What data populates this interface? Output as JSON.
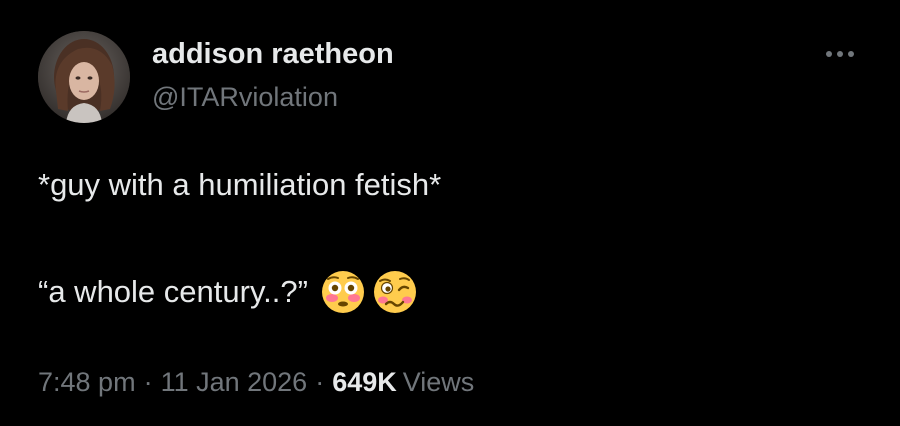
{
  "author": {
    "display_name": "addison raetheon",
    "handle": "@ITARviolation"
  },
  "tweet": {
    "line1": "*guy with a humiliation fetish*",
    "line2": "“a whole century..?”",
    "emojis": [
      "flushed-face",
      "woozy-face"
    ]
  },
  "meta": {
    "time": "7:48 pm",
    "separator": "·",
    "date": "11 Jan 2026",
    "views_count": "649K",
    "views_label": "Views"
  },
  "colors": {
    "background": "#000000",
    "primary_text": "#e7e9ea",
    "secondary_text": "#71767b",
    "emoji_yellow": "#ffcc4d"
  },
  "icons": {
    "more": "more-horizontal-icon"
  }
}
